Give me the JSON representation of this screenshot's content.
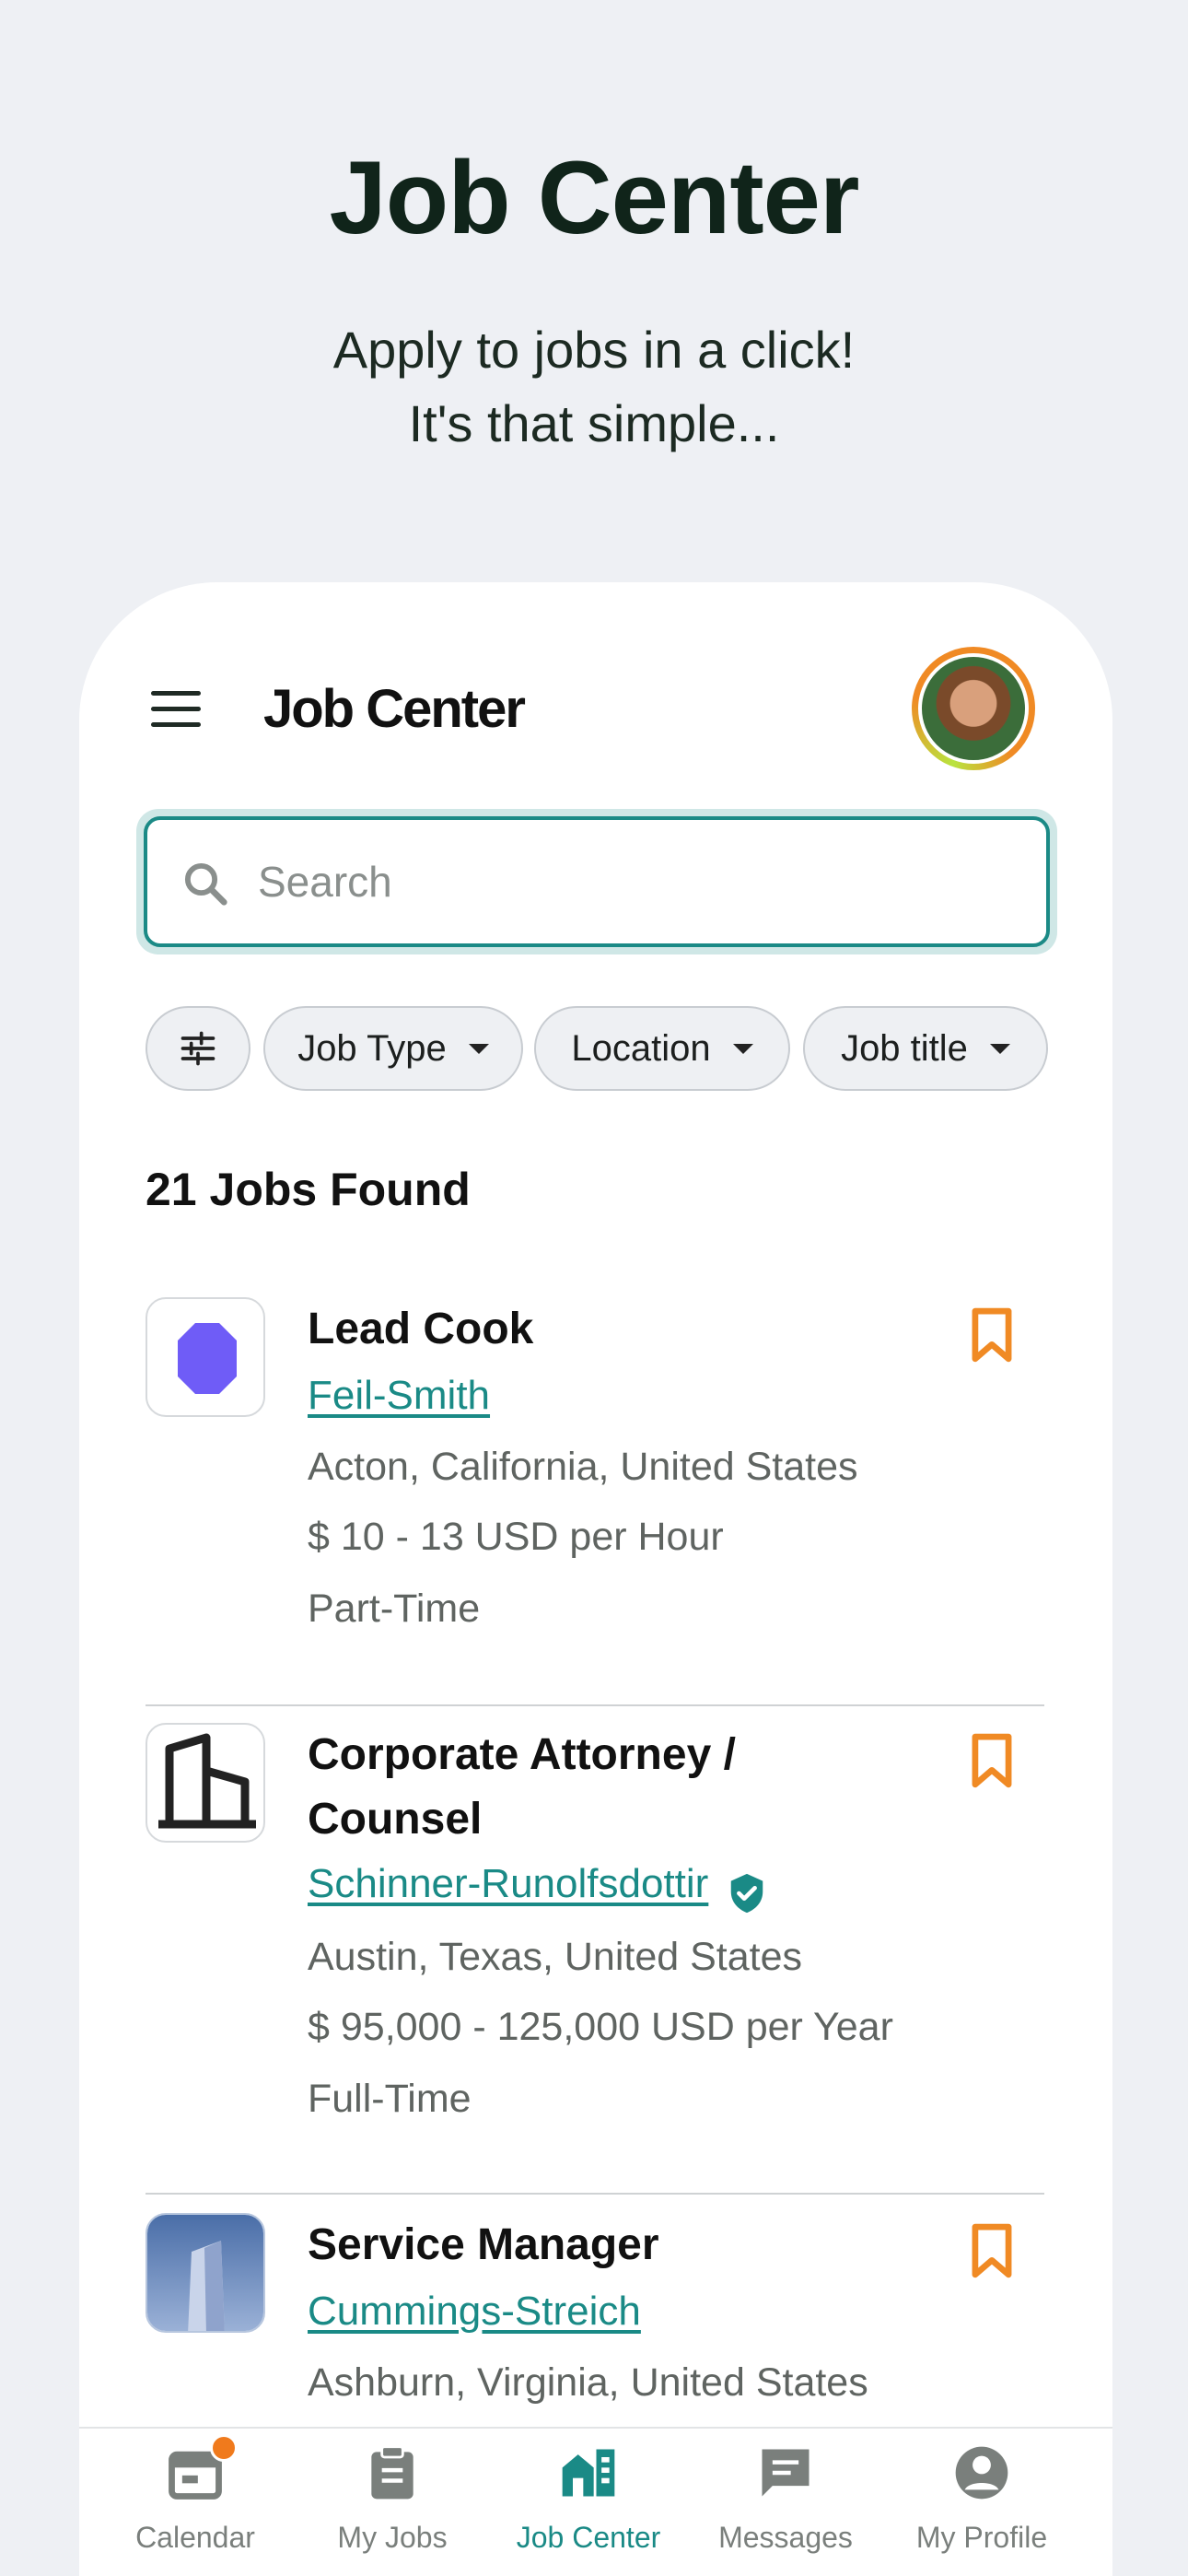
{
  "hero": {
    "title": "Job Center",
    "subtitle_line1": "Apply to jobs in a click!",
    "subtitle_line2": "It's that simple..."
  },
  "app": {
    "title": "Job Center",
    "search_placeholder": "Search"
  },
  "filters": {
    "chips": [
      "Job Type",
      "Location",
      "Job title"
    ]
  },
  "results": {
    "count_label": "21 Jobs Found"
  },
  "jobs": [
    {
      "title": "Lead Cook",
      "company": "Feil-Smith",
      "location": "Acton, California, United States",
      "salary": "$ 10 - 13 USD per Hour",
      "type": "Part-Time",
      "verified": false
    },
    {
      "title": "Corporate Attorney / Counsel",
      "company": "Schinner-Runolfsdottir",
      "location": "Austin, Texas, United States",
      "salary": "$ 95,000 - 125,000 USD per Year",
      "type": "Full-Time",
      "verified": true
    },
    {
      "title": "Service Manager",
      "company": "Cummings-Streich",
      "location": "Ashburn, Virginia, United States",
      "verified": false
    }
  ],
  "nav": {
    "items": [
      {
        "label": "Calendar",
        "icon": "calendar-icon",
        "badge": true
      },
      {
        "label": "My Jobs",
        "icon": "clipboard-icon"
      },
      {
        "label": "Job Center",
        "icon": "job-center-icon",
        "active": true
      },
      {
        "label": "Messages",
        "icon": "message-icon"
      },
      {
        "label": "My Profile",
        "icon": "profile-icon"
      }
    ]
  },
  "colors": {
    "accent": "#1a8a86",
    "bookmark": "#f08a24",
    "background": "#eef0f4"
  }
}
